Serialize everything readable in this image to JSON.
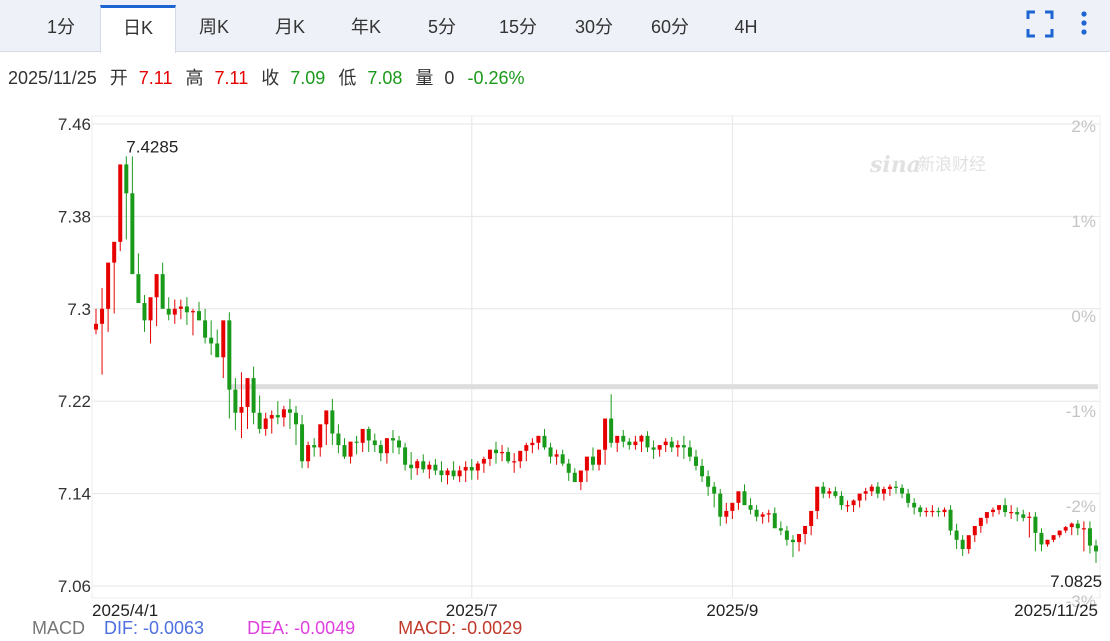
{
  "tabs": [
    {
      "label": "1分",
      "left": 0
    },
    {
      "label": "日K",
      "active": true
    },
    {
      "label": "周K"
    },
    {
      "label": "月K"
    },
    {
      "label": "年K"
    },
    {
      "label": "5分"
    },
    {
      "label": "15分"
    },
    {
      "label": "30分"
    },
    {
      "label": "60分"
    },
    {
      "label": "4H"
    }
  ],
  "info": {
    "date": "2025/11/25",
    "open_label": "开",
    "open": "7.11",
    "high_label": "高",
    "high": "7.11",
    "close_label": "收",
    "close": "7.09",
    "low_label": "低",
    "low": "7.08",
    "volume_label": "量",
    "volume": "0",
    "change": "-0.26%"
  },
  "macd": {
    "label": "MACD",
    "dif": "DIF: -0.0063",
    "dea": "DEA: -0.0049",
    "macd": "MACD: -0.0029"
  },
  "colors": {
    "up": "#e60000",
    "down": "#1a9a1a",
    "accent": "#1e64d2",
    "dif": "#4d6fe0",
    "dea": "#e040e0",
    "macd": "#c0392b"
  },
  "watermark": "新浪财经",
  "chart_data": {
    "type": "candlestick",
    "y_ticks": [
      "7.46",
      "7.38",
      "7.3",
      "7.22",
      "7.14",
      "7.06"
    ],
    "y_tick_values": [
      7.46,
      7.38,
      7.3,
      7.22,
      7.14,
      7.06
    ],
    "pct_ticks": [
      "2%",
      "1%",
      "0%",
      "-1%",
      "-2%",
      "-3%"
    ],
    "pct_tick_values": [
      2,
      1,
      0,
      -1,
      -2,
      -3
    ],
    "x_ticks": [
      "2025/4/1",
      "2025/7",
      "2025/9",
      "2025/11/25"
    ],
    "x_tick_index": [
      0,
      62,
      105,
      167
    ],
    "ylim": [
      7.046,
      7.47
    ],
    "grid": true,
    "reference_price": 7.233,
    "max_label": "7.4285",
    "max_index": 5,
    "min_label": "7.0825",
    "min_index": 167,
    "open": [
      7.282,
      7.287,
      7.3,
      7.34,
      7.358,
      7.425,
      7.4,
      7.33,
      7.305,
      7.29,
      7.31,
      7.33,
      7.3,
      7.295,
      7.3,
      7.302,
      7.297,
      7.298,
      7.29,
      7.275,
      7.27,
      7.258,
      7.29,
      7.23,
      7.21,
      7.215,
      7.24,
      7.21,
      7.196,
      7.205,
      7.208,
      7.206,
      7.213,
      7.21,
      7.2,
      7.168,
      7.182,
      7.18,
      7.2,
      7.212,
      7.192,
      7.182,
      7.172,
      7.185,
      7.184,
      7.196,
      7.186,
      7.182,
      7.175,
      7.188,
      7.186,
      7.18,
      7.165,
      7.162,
      7.168,
      7.161,
      7.165,
      7.16,
      7.156,
      7.16,
      7.155,
      7.16,
      7.163,
      7.16,
      7.166,
      7.17,
      7.178,
      7.175,
      7.176,
      7.168,
      7.168,
      7.177,
      7.182,
      7.184,
      7.19,
      7.18,
      7.172,
      7.174,
      7.166,
      7.158,
      7.15,
      7.16,
      7.172,
      7.165,
      7.178,
      7.205,
      7.184,
      7.19,
      7.185,
      7.182,
      7.185,
      7.19,
      7.18,
      7.178,
      7.182,
      7.185,
      7.18,
      7.182,
      7.18,
      7.172,
      7.164,
      7.155,
      7.146,
      7.14,
      7.12,
      7.125,
      7.132,
      7.142,
      7.13,
      7.126,
      7.12,
      7.122,
      7.123,
      7.11,
      7.108,
      7.1,
      7.098,
      7.105,
      7.112,
      7.125,
      7.146,
      7.14,
      7.142,
      7.138,
      7.13,
      7.13,
      7.134,
      7.14,
      7.142,
      7.146,
      7.14,
      7.144,
      7.146,
      7.145,
      7.14,
      7.132,
      7.128,
      7.124,
      7.125,
      7.125,
      7.124,
      7.126,
      7.108,
      7.1,
      7.092,
      7.104,
      7.112,
      7.119,
      7.124,
      7.126,
      7.13,
      7.124,
      7.124,
      7.122,
      7.119,
      7.12,
      7.106,
      7.096,
      7.1,
      7.104,
      7.108,
      7.111,
      7.114,
      7.11,
      7.11,
      7.095
    ],
    "high": [
      7.3,
      7.318,
      7.338,
      7.35,
      7.412,
      7.432,
      7.432,
      7.348,
      7.312,
      7.3,
      7.33,
      7.34,
      7.31,
      7.308,
      7.308,
      7.31,
      7.3,
      7.306,
      7.3,
      7.29,
      7.282,
      7.275,
      7.297,
      7.24,
      7.245,
      7.225,
      7.25,
      7.225,
      7.21,
      7.212,
      7.22,
      7.216,
      7.222,
      7.216,
      7.208,
      7.185,
      7.188,
      7.19,
      7.208,
      7.222,
      7.2,
      7.188,
      7.18,
      7.19,
      7.188,
      7.198,
      7.192,
      7.186,
      7.182,
      7.195,
      7.19,
      7.184,
      7.176,
      7.17,
      7.174,
      7.168,
      7.17,
      7.168,
      7.162,
      7.168,
      7.164,
      7.168,
      7.17,
      7.168,
      7.172,
      7.178,
      7.185,
      7.182,
      7.18,
      7.175,
      7.176,
      7.184,
      7.188,
      7.19,
      7.196,
      7.184,
      7.178,
      7.178,
      7.17,
      7.162,
      7.158,
      7.168,
      7.18,
      7.178,
      7.192,
      7.226,
      7.188,
      7.195,
      7.188,
      7.19,
      7.191,
      7.194,
      7.186,
      7.182,
      7.188,
      7.189,
      7.186,
      7.19,
      7.186,
      7.178,
      7.17,
      7.16,
      7.15,
      7.144,
      7.132,
      7.132,
      7.137,
      7.148,
      7.136,
      7.13,
      7.124,
      7.126,
      7.128,
      7.116,
      7.112,
      7.104,
      7.104,
      7.11,
      7.118,
      7.128,
      7.15,
      7.145,
      7.146,
      7.142,
      7.134,
      7.135,
      7.138,
      7.145,
      7.148,
      7.15,
      7.146,
      7.148,
      7.151,
      7.148,
      7.144,
      7.136,
      7.13,
      7.128,
      7.13,
      7.128,
      7.128,
      7.13,
      7.114,
      7.104,
      7.098,
      7.108,
      7.116,
      7.122,
      7.128,
      7.13,
      7.136,
      7.13,
      7.128,
      7.126,
      7.124,
      7.124,
      7.11,
      7.1,
      7.104,
      7.108,
      7.112,
      7.115,
      7.117,
      7.116,
      7.116,
      7.1
    ],
    "low": [
      7.278,
      7.243,
      7.28,
      7.296,
      7.35,
      7.36,
      7.36,
      7.305,
      7.28,
      7.27,
      7.285,
      7.302,
      7.29,
      7.287,
      7.291,
      7.286,
      7.277,
      7.29,
      7.27,
      7.26,
      7.262,
      7.24,
      7.205,
      7.195,
      7.188,
      7.196,
      7.2,
      7.192,
      7.19,
      7.192,
      7.2,
      7.198,
      7.196,
      7.182,
      7.162,
      7.162,
      7.172,
      7.172,
      7.182,
      7.182,
      7.175,
      7.17,
      7.166,
      7.174,
      7.176,
      7.176,
      7.176,
      7.168,
      7.166,
      7.175,
      7.174,
      7.16,
      7.152,
      7.156,
      7.158,
      7.153,
      7.156,
      7.15,
      7.148,
      7.152,
      7.15,
      7.15,
      7.152,
      7.152,
      7.158,
      7.164,
      7.166,
      7.168,
      7.166,
      7.158,
      7.162,
      7.168,
      7.175,
      7.178,
      7.178,
      7.166,
      7.165,
      7.164,
      7.151,
      7.15,
      7.143,
      7.15,
      7.16,
      7.16,
      7.165,
      7.18,
      7.176,
      7.18,
      7.178,
      7.178,
      7.176,
      7.176,
      7.17,
      7.172,
      7.176,
      7.176,
      7.172,
      7.17,
      7.168,
      7.16,
      7.15,
      7.138,
      7.128,
      7.112,
      7.114,
      7.118,
      7.126,
      7.13,
      7.122,
      7.116,
      7.114,
      7.115,
      7.11,
      7.104,
      7.095,
      7.085,
      7.09,
      7.096,
      7.104,
      7.118,
      7.136,
      7.136,
      7.136,
      7.126,
      7.124,
      7.124,
      7.128,
      7.134,
      7.138,
      7.136,
      7.134,
      7.138,
      7.14,
      7.136,
      7.128,
      7.122,
      7.12,
      7.12,
      7.12,
      7.12,
      7.12,
      7.104,
      7.092,
      7.086,
      7.088,
      7.098,
      7.106,
      7.114,
      7.12,
      7.122,
      7.12,
      7.118,
      7.116,
      7.116,
      7.102,
      7.09,
      7.09,
      7.094,
      7.098,
      7.102,
      7.106,
      7.104,
      7.104,
      7.09,
      7.088,
      7.08
    ],
    "close": [
      7.287,
      7.3,
      7.34,
      7.358,
      7.425,
      7.4,
      7.33,
      7.305,
      7.29,
      7.31,
      7.33,
      7.3,
      7.295,
      7.3,
      7.302,
      7.297,
      7.298,
      7.29,
      7.275,
      7.27,
      7.258,
      7.29,
      7.23,
      7.21,
      7.215,
      7.24,
      7.21,
      7.196,
      7.205,
      7.208,
      7.206,
      7.213,
      7.21,
      7.2,
      7.168,
      7.182,
      7.18,
      7.2,
      7.212,
      7.192,
      7.182,
      7.172,
      7.185,
      7.184,
      7.196,
      7.186,
      7.182,
      7.175,
      7.188,
      7.186,
      7.18,
      7.165,
      7.162,
      7.168,
      7.161,
      7.165,
      7.16,
      7.156,
      7.16,
      7.155,
      7.16,
      7.163,
      7.16,
      7.166,
      7.17,
      7.178,
      7.175,
      7.176,
      7.168,
      7.168,
      7.177,
      7.182,
      7.184,
      7.19,
      7.18,
      7.172,
      7.174,
      7.166,
      7.158,
      7.15,
      7.16,
      7.172,
      7.165,
      7.178,
      7.205,
      7.184,
      7.19,
      7.185,
      7.182,
      7.185,
      7.19,
      7.18,
      7.178,
      7.182,
      7.185,
      7.18,
      7.182,
      7.18,
      7.172,
      7.164,
      7.155,
      7.146,
      7.14,
      7.12,
      7.125,
      7.132,
      7.142,
      7.13,
      7.126,
      7.12,
      7.122,
      7.123,
      7.11,
      7.108,
      7.1,
      7.098,
      7.105,
      7.112,
      7.125,
      7.146,
      7.14,
      7.142,
      7.138,
      7.13,
      7.13,
      7.134,
      7.14,
      7.142,
      7.146,
      7.14,
      7.144,
      7.146,
      7.145,
      7.14,
      7.132,
      7.128,
      7.124,
      7.125,
      7.125,
      7.124,
      7.126,
      7.108,
      7.1,
      7.092,
      7.104,
      7.112,
      7.119,
      7.124,
      7.126,
      7.13,
      7.124,
      7.124,
      7.122,
      7.119,
      7.12,
      7.106,
      7.096,
      7.1,
      7.104,
      7.108,
      7.111,
      7.114,
      7.11,
      7.11,
      7.095,
      7.09
    ]
  }
}
